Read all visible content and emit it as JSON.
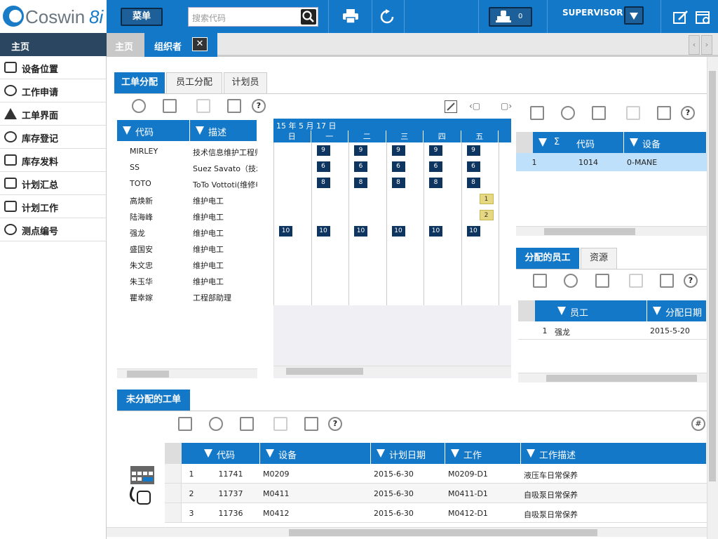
{
  "app": {
    "logo_text": "Coswin",
    "logo_suffix": "8i"
  },
  "topbar": {
    "menu_label": "菜单",
    "search_placeholder": "搜索代码",
    "message_count": "0",
    "user": "SUPERVISOR"
  },
  "sidebar": {
    "home": "主页",
    "items": [
      {
        "label": "设备位置",
        "icon": "equipment-location-icon"
      },
      {
        "label": "工作申请",
        "icon": "work-request-icon"
      },
      {
        "label": "工单界面",
        "icon": "work-order-cone-icon"
      },
      {
        "label": "库存登记",
        "icon": "stock-register-icon"
      },
      {
        "label": "库存发料",
        "icon": "stock-issue-icon"
      },
      {
        "label": "计划汇总",
        "icon": "plan-summary-icon"
      },
      {
        "label": "计划工作",
        "icon": "planned-work-icon"
      },
      {
        "label": "测点编号",
        "icon": "meter-point-icon"
      }
    ]
  },
  "tabs": {
    "home": "主页",
    "organizer": "组织者",
    "close": "✕"
  },
  "subtabs": [
    "工单分配",
    "员工分配",
    "计划员"
  ],
  "employees": {
    "headers": [
      "代码",
      "描述"
    ],
    "rows": [
      {
        "code": "MIRLEY",
        "desc": "技术信息维护工程师"
      },
      {
        "code": "SS",
        "desc": "Suez Savato（技术"
      },
      {
        "code": "TOTO",
        "desc": "ToTo Vottoti(维修电工"
      },
      {
        "code": "高焕新",
        "desc": "维护电工"
      },
      {
        "code": "陆海峰",
        "desc": "维护电工"
      },
      {
        "code": "强龙",
        "desc": "维护电工"
      },
      {
        "code": "盛国安",
        "desc": "维护电工"
      },
      {
        "code": "朱文忠",
        "desc": "维护电工"
      },
      {
        "code": "朱玉华",
        "desc": "维护电工"
      },
      {
        "code": "瞿幸嫁",
        "desc": "工程部助理"
      }
    ]
  },
  "calendar": {
    "date_label": "15 年 5 月 17 日",
    "days": [
      "日",
      "一",
      "二",
      "三",
      "四",
      "五"
    ],
    "rows": [
      {
        "blocks": [
          "",
          "9",
          "9",
          "9",
          "9",
          "9"
        ],
        "yellow": null
      },
      {
        "blocks": [
          "",
          "6",
          "6",
          "6",
          "6",
          "6"
        ],
        "yellow": null
      },
      {
        "blocks": [
          "",
          "8",
          "8",
          "8",
          "8",
          "8"
        ],
        "yellow": null
      },
      {
        "blocks": [
          "",
          "",
          "",
          "",
          "",
          ""
        ],
        "yellow": "1"
      },
      {
        "blocks": [
          "",
          "",
          "",
          "",
          "",
          ""
        ],
        "yellow": "2"
      },
      {
        "blocks": [
          "10",
          "10",
          "10",
          "10",
          "10",
          "10"
        ],
        "yellow": null
      }
    ]
  },
  "orders": {
    "headers": [
      "Σ",
      "代码",
      "设备"
    ],
    "rows": [
      {
        "n": "1",
        "code": "1014",
        "equip": "0-MANE"
      }
    ]
  },
  "assign_tabs": [
    "分配的员工",
    "资源"
  ],
  "assigned": {
    "headers": [
      "员工",
      "分配日期"
    ],
    "rows": [
      {
        "n": "1",
        "emp": "强龙",
        "date": "2015-5-20"
      }
    ]
  },
  "unassigned": {
    "title": "未分配的工单",
    "headers": [
      "代码",
      "设备",
      "计划日期",
      "工作",
      "工作描述"
    ],
    "rows": [
      {
        "n": "1",
        "code": "11741",
        "equip": "M0209",
        "date": "2015-6-30",
        "job": "M0209-D1",
        "desc": "液压车日常保养"
      },
      {
        "n": "2",
        "code": "11737",
        "equip": "M0411",
        "date": "2015-6-30",
        "job": "M0411-D1",
        "desc": "自吸泵日常保养"
      },
      {
        "n": "3",
        "code": "11736",
        "equip": "M0412",
        "date": "2015-6-30",
        "job": "M0412-D1",
        "desc": "自吸泵日常保养"
      }
    ]
  },
  "colors": {
    "primary": "#1478c8",
    "sidebar_dark": "#2a4660",
    "block": "#0d3560",
    "highlight": "#bfe0fa"
  }
}
